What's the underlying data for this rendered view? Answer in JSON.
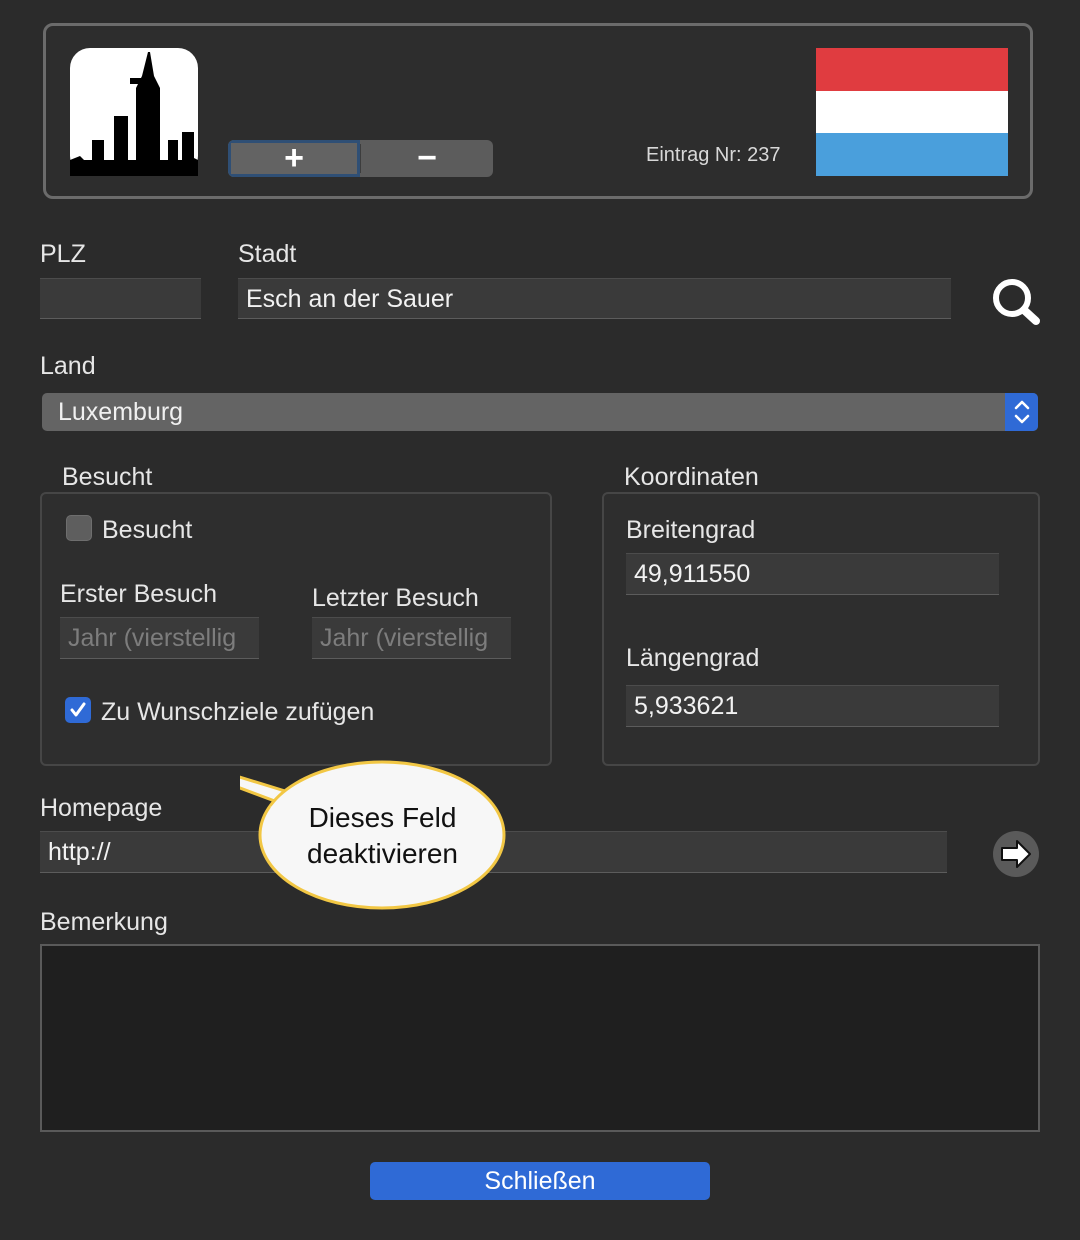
{
  "header": {
    "plus_label": "+",
    "minus_label": "−",
    "entry_label": "Eintrag Nr: 237",
    "flag_colors": [
      "#e03c40",
      "#ffffff",
      "#4a9fdc"
    ],
    "city_icon": "city-skyline-icon"
  },
  "fields": {
    "plz_label": "PLZ",
    "plz_value": "",
    "stadt_label": "Stadt",
    "stadt_value": "Esch an der Sauer",
    "search_icon": "search-icon",
    "land_label": "Land",
    "land_value": "Luxemburg"
  },
  "besucht": {
    "group_title": "Besucht",
    "checkbox_label": "Besucht",
    "checkbox_checked": false,
    "erster_label": "Erster Besuch",
    "erster_placeholder": "Jahr (vierstellig",
    "letzter_label": "Letzter Besuch",
    "letzter_placeholder": "Jahr (vierstellig",
    "wunsch_label": "Zu Wunschziele zufügen",
    "wunsch_checked": true
  },
  "koordinaten": {
    "group_title": "Koordinaten",
    "breite_label": "Breitengrad",
    "breite_value": "49,911550",
    "laenge_label": "Längengrad",
    "laenge_value": "5,933621"
  },
  "homepage": {
    "label": "Homepage",
    "value": "http://",
    "go_icon": "arrow-right-icon"
  },
  "bemerkung": {
    "label": "Bemerkung",
    "value": ""
  },
  "callout": {
    "line1": "Dieses Feld",
    "line2": "deaktivieren"
  },
  "footer": {
    "close_label": "Schließen",
    "accent": "#2f6ad6"
  }
}
